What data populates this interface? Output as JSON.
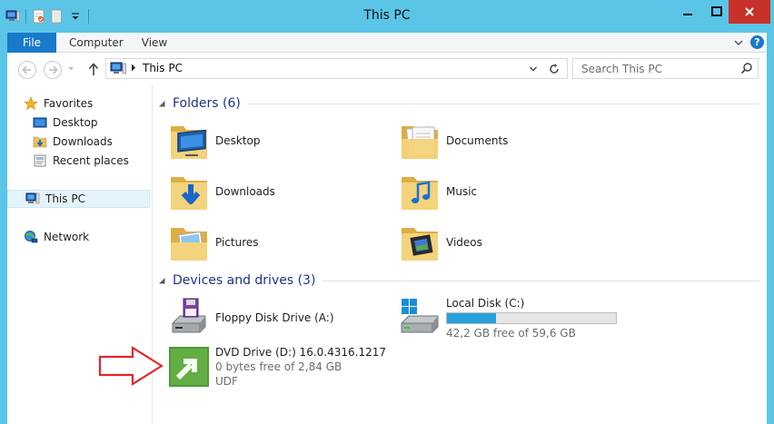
{
  "window": {
    "title": "This PC",
    "frame_color": "#5bc5e8",
    "close_color": "#c7312a"
  },
  "qat": {
    "icons": [
      "properties-icon",
      "new-folder-icon",
      "customize-dropdown-icon"
    ]
  },
  "ribbon": {
    "tabs": [
      {
        "label": "File",
        "active": true
      },
      {
        "label": "Computer"
      },
      {
        "label": "View"
      }
    ],
    "help_label": "?"
  },
  "address": {
    "path": "This PC",
    "search_placeholder": "Search This PC"
  },
  "nav": {
    "favorites_label": "Favorites",
    "favorites": [
      {
        "label": "Desktop",
        "icon": "desktop-icon"
      },
      {
        "label": "Downloads",
        "icon": "downloads-icon"
      },
      {
        "label": "Recent places",
        "icon": "recent-places-icon"
      }
    ],
    "this_pc_label": "This PC",
    "network_label": "Network"
  },
  "folders": {
    "header": "Folders (6)",
    "items": [
      {
        "label": "Desktop",
        "icon": "desktop-folder-icon"
      },
      {
        "label": "Documents",
        "icon": "documents-folder-icon"
      },
      {
        "label": "Downloads",
        "icon": "downloads-folder-icon"
      },
      {
        "label": "Music",
        "icon": "music-folder-icon"
      },
      {
        "label": "Pictures",
        "icon": "pictures-folder-icon"
      },
      {
        "label": "Videos",
        "icon": "videos-folder-icon"
      }
    ]
  },
  "drives": {
    "header": "Devices and drives (3)",
    "floppy": {
      "label": "Floppy Disk Drive (A:)"
    },
    "local": {
      "label": "Local Disk (C:)",
      "free_text": "42,2 GB free of 59,6 GB",
      "used_fraction": 0.29,
      "bar_color": "#26a0da"
    },
    "dvd": {
      "label": "DVD Drive (D:) 16.0.4316.1217",
      "free_text": "0 bytes free of 2,84 GB",
      "fs": "UDF"
    }
  },
  "annotation": {
    "arrow_color": "#e3262b"
  }
}
